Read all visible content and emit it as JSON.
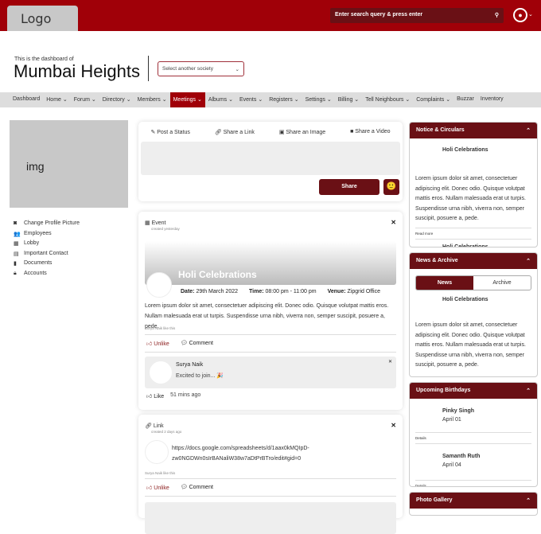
{
  "header": {
    "logo": "Logo",
    "search_placeholder": "Enter search query & press enter",
    "search_icon": "magnifier",
    "avatar_icon": "user-circle"
  },
  "society": {
    "subtitle": "This is the dashboard of",
    "name": "Mumbai Heights",
    "select_placeholder": "Select another society"
  },
  "nav": [
    {
      "label": "Dashboard"
    },
    {
      "label": "Home ⌄"
    },
    {
      "label": "Forum ⌄"
    },
    {
      "label": "Directory ⌄"
    },
    {
      "label": "Members ⌄"
    },
    {
      "label": "Meetings ⌄",
      "active": true
    },
    {
      "label": "Albums ⌄"
    },
    {
      "label": "Events ⌄"
    },
    {
      "label": "Registers ⌄"
    },
    {
      "label": "Settings ⌄"
    },
    {
      "label": "Billing ⌄"
    },
    {
      "label": "Tell Neighbours ⌄"
    },
    {
      "label": "Complaints ⌄"
    },
    {
      "label": "Buzzar"
    },
    {
      "label": "Inventory"
    }
  ],
  "profile": {
    "image_placeholder": "img",
    "links": [
      {
        "icon": "camera",
        "label": "Change Profile Picture"
      },
      {
        "icon": "users",
        "label": "Employees"
      },
      {
        "icon": "building",
        "label": "Lobby"
      },
      {
        "icon": "address-book",
        "label": "Important Contact"
      },
      {
        "icon": "file",
        "label": "Documents"
      },
      {
        "icon": "lock",
        "label": "Accounts"
      }
    ]
  },
  "composer": {
    "tabs": [
      "Post a Status",
      "Share a Link",
      "Share an Image",
      "Share a Video"
    ],
    "share": "Share",
    "emoji": "🙂"
  },
  "event_post": {
    "type": "Event",
    "created": "created yesterday",
    "title": "Holi Celebrations",
    "date_label": "Date:",
    "date": "29th March 2022",
    "time_label": "Time:",
    "time": "08:00 pm - 11:00 pm",
    "venue_label": "Venue:",
    "venue": "Zipgrid Office",
    "description": "Lorem ipsum dolor sit amet, consectetuer adipiscing elit. Donec odio. Quisque volutpat mattis eros. Nullam malesuada erat ut turpis. Suspendisse urna nibh, viverra non, semper suscipit, posuere a, pede.",
    "likes": "Surya Naik like this",
    "unlike": "Unlike",
    "comment": "Comment",
    "comment_item": {
      "author": "Surya Naik",
      "text": "Excited to join... 🎉",
      "like": "Like",
      "time": "51 mins ago"
    }
  },
  "link_post": {
    "type": "Link",
    "created": "created 2 days ago",
    "url_line1": "https://docs.google.com/spreadsheets/d/1aax0kMQIpD-",
    "url_line2": "zw0NGDWn0sIrBANaliW38w7aDtPrBTro/edit#gid=0",
    "likes": "Surya Naik like this",
    "unlike": "Unlike",
    "comment": "Comment"
  },
  "notices": {
    "title": "Notice & Circulars",
    "item_title": "Holi Celebrations",
    "text": "Lorem ipsum dolor sit amet, consectetuer adipiscing elit. Donec odio. Quisque volutpat mattis eros. Nullam malesuada erat ut turpis. Suspendisse urna nibh, viverra non, semper suscipit, posuere a, pede.",
    "read_more": "Read more",
    "item2_title": "Holi Celebrations"
  },
  "news": {
    "title": "News & Archive",
    "tab_news": "News",
    "tab_archive": "Archive",
    "item_title": "Holi Celebrations",
    "text": "Lorem ipsum dolor sit amet, consectetuer adipiscing elit. Donec odio. Quisque volutpat mattis eros. Nullam malesuada erat ut turpis. Suspendisse urna nibh, viverra non, semper suscipit, posuere a, pede."
  },
  "birthdays": {
    "title": "Upcoming Birthdays",
    "items": [
      {
        "name": "Pinky Singh",
        "date": "April 01",
        "details": "Details"
      },
      {
        "name": "Samanth Ruth",
        "date": "April 04",
        "details": "Details"
      }
    ]
  },
  "gallery": {
    "title": "Photo Gallery"
  },
  "colors": {
    "primary": "#a00008",
    "dark": "#6a1015"
  }
}
